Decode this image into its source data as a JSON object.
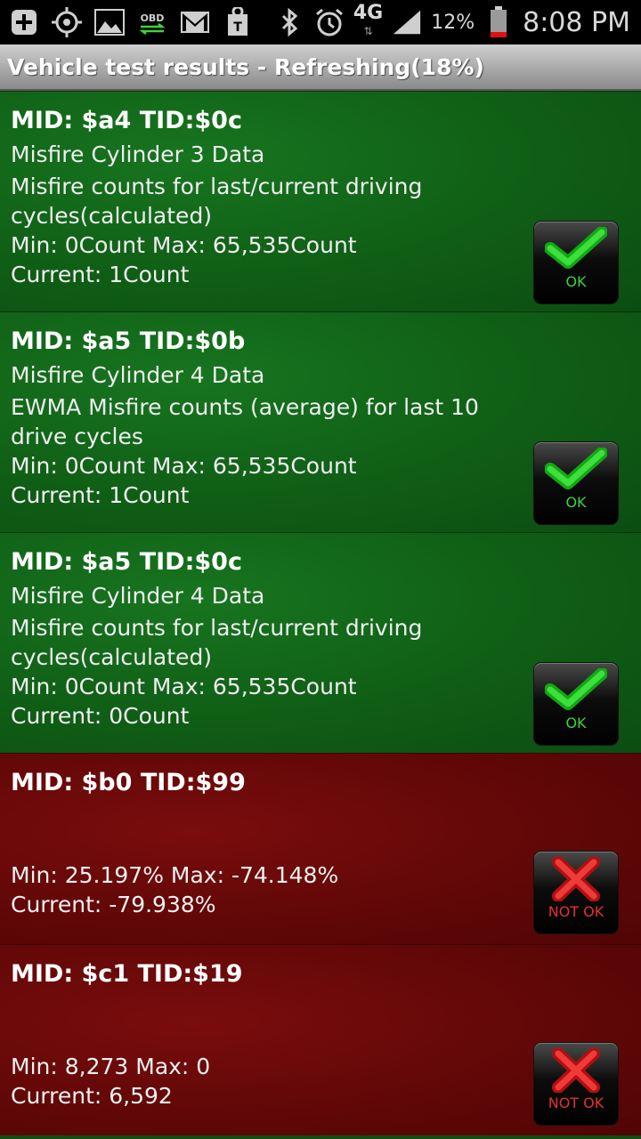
{
  "statusbar": {
    "network": "4G",
    "battery": "12%",
    "time": "8:08 PM",
    "icons": [
      "add-icon",
      "gps-icon",
      "image-icon",
      "obd-icon",
      "gmail-icon",
      "tmobile-icon",
      "bluetooth-icon",
      "alarm-icon",
      "signal-icon",
      "battery-icon"
    ]
  },
  "title": "Vehicle test results - Refreshing(18%)",
  "results": [
    {
      "header": "MID: $a4 TID:$0c",
      "name": "Misfire Cylinder 3 Data",
      "description": "Misfire counts for last/current driving cycles(calculated)",
      "minmax": "Min: 0Count  Max: 65,535Count",
      "current": "Current: 1Count",
      "status": "OK"
    },
    {
      "header": "MID: $a5 TID:$0b",
      "name": "Misfire Cylinder 4 Data",
      "description": "EWMA Misfire counts (average) for last 10 drive cycles",
      "minmax": "Min: 0Count  Max: 65,535Count",
      "current": "Current: 1Count",
      "status": "OK"
    },
    {
      "header": "MID: $a5 TID:$0c",
      "name": "Misfire Cylinder 4 Data",
      "description": "Misfire counts for last/current driving cycles(calculated)",
      "minmax": "Min: 0Count  Max: 65,535Count",
      "current": "Current: 0Count",
      "status": "OK"
    },
    {
      "header": "MID: $b0 TID:$99",
      "minmax": "Min: 25.197%  Max: -74.148%",
      "current": "Current: -79.938%",
      "status": "NOT OK"
    },
    {
      "header": "MID: $c1 TID:$19",
      "minmax": "Min: 8,273  Max: 0",
      "current": "Current: 6,592",
      "status": "NOT OK"
    }
  ],
  "colors": {
    "ok_bg": "#0f5c15",
    "notok_bg": "#600707",
    "ok_text": "#3cd43c",
    "notok_text": "#e23030"
  }
}
